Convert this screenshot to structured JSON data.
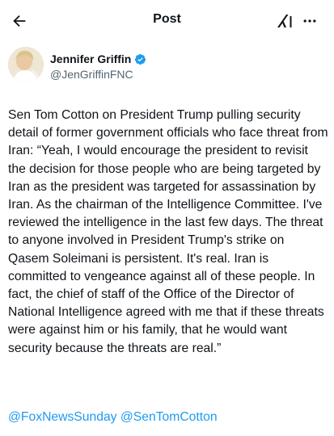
{
  "header": {
    "title": "Post",
    "back_icon": "arrow-left-icon",
    "grok_icon": "grok-icon",
    "more_icon": "more-horizontal-icon"
  },
  "author": {
    "name": "Jennifer Griffin",
    "handle": "@JenGriffinFNC",
    "verified": true,
    "verified_color": "#1d9bf0"
  },
  "post": {
    "text": "Sen Tom Cotton on President Trump pulling security detail of former government officials who face threat from Iran: “Yeah, I would encourage the president to revisit the decision for those people who are being targeted by Iran as the president was targeted for assassination by Iran. As the chairman of the Intelligence Committee. I've reviewed the intelligence in the last few days. The threat to anyone involved in President Trump's strike on Qasem Soleimani is persistent. It's real. Iran is committed to vengeance against all of these people. In fact, the chief of staff of the Office of the Director of National Intelligence agreed with me that if these threats were against him or his family, that he would want security because the threats are real.”",
    "mentions": [
      "@FoxNewsSunday",
      "@SenTomCotton"
    ],
    "link_color": "#1d9bf0"
  }
}
